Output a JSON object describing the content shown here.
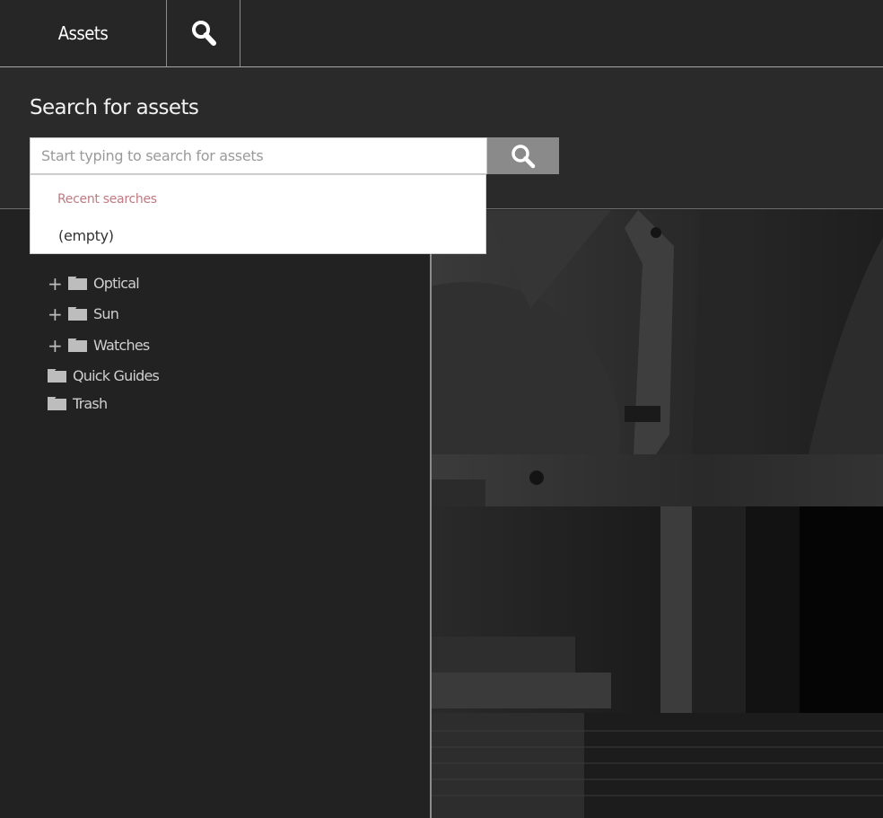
{
  "header": {
    "tabs": [
      {
        "label": "Assets",
        "icon": ""
      },
      {
        "label": "",
        "icon": "search-icon"
      }
    ]
  },
  "search": {
    "title": "Search for assets",
    "placeholder": "Start typing to search for assets",
    "value": "",
    "button_icon": "search-icon",
    "recent": {
      "heading": "Recent searches",
      "empty_label": "(empty)"
    }
  },
  "tree": {
    "items": [
      {
        "label": "Optical",
        "expandable": true,
        "icon": "folder-icon"
      },
      {
        "label": "Sun",
        "expandable": true,
        "icon": "folder-icon"
      },
      {
        "label": "Watches",
        "expandable": true,
        "icon": "folder-icon"
      },
      {
        "label": "Quick Guides",
        "expandable": false,
        "icon": "folder-icon"
      },
      {
        "label": "Trash",
        "expandable": false,
        "icon": "folder-icon"
      }
    ],
    "toggle_symbol": "+"
  },
  "colors": {
    "background": "#222222",
    "header": "#262626",
    "search_button": "#8a8a8a",
    "recent_heading": "#c07a82"
  }
}
